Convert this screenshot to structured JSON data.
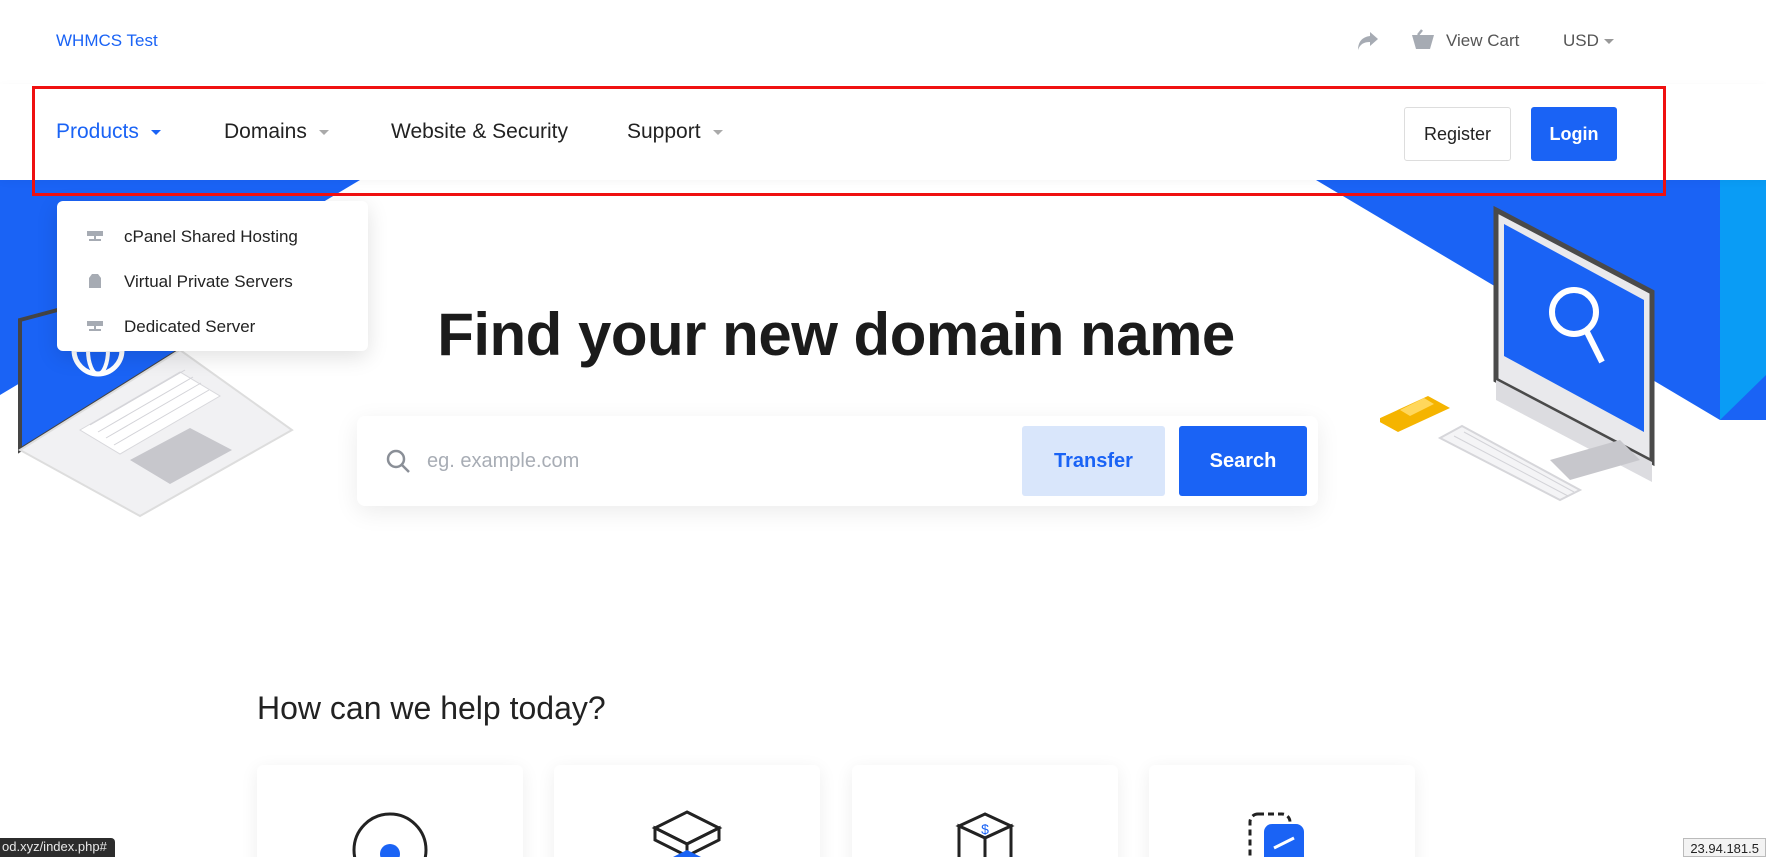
{
  "header": {
    "brand": "WHMCS Test",
    "cart_label": "View Cart",
    "currency": "USD"
  },
  "nav": {
    "items": [
      {
        "label": "Products",
        "active": true
      },
      {
        "label": "Domains"
      },
      {
        "label": "Website & Security"
      },
      {
        "label": "Support"
      }
    ],
    "register_label": "Register",
    "login_label": "Login"
  },
  "products_dropdown": {
    "items": [
      {
        "label": "cPanel Shared Hosting",
        "icon": "server-icon"
      },
      {
        "label": "Virtual Private Servers",
        "icon": "box-icon"
      },
      {
        "label": "Dedicated Server",
        "icon": "server-icon"
      }
    ]
  },
  "hero": {
    "title": "Find your new domain name",
    "search_placeholder": "eg. example.com",
    "transfer_label": "Transfer",
    "search_label": "Search"
  },
  "help": {
    "heading": "How can we help today?"
  },
  "browser": {
    "status_url": "od.xyz/index.php#",
    "ip": "23.94.181.5"
  },
  "colors": {
    "primary": "#1a63f5",
    "accent_yellow": "#f5b400",
    "highlight": "#ef1010"
  }
}
